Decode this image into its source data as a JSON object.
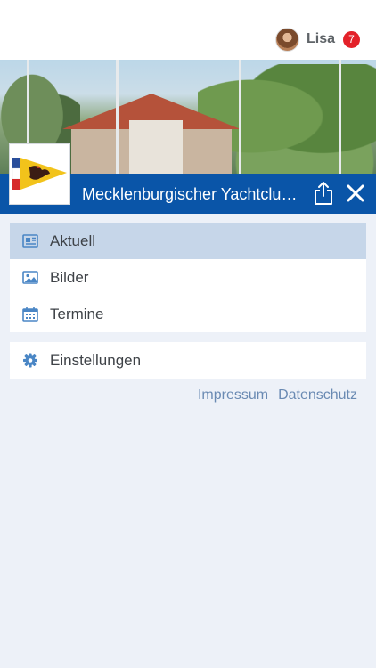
{
  "header": {
    "user_name": "Lisa",
    "notification_count": "7"
  },
  "club": {
    "title": "Mecklenburgischer Yachtclub..."
  },
  "menu": {
    "items": [
      {
        "label": "Aktuell",
        "icon": "newspaper-icon",
        "active": true
      },
      {
        "label": "Bilder",
        "icon": "image-icon",
        "active": false
      },
      {
        "label": "Termine",
        "icon": "calendar-icon",
        "active": false
      }
    ],
    "settings_label": "Einstellungen",
    "settings_icon": "gear-icon"
  },
  "footer_links": {
    "impressum": "Impressum",
    "datenschutz": "Datenschutz"
  },
  "colors": {
    "accent": "#0a55a8",
    "active_item": "#c6d6e9",
    "background": "#edf1f8",
    "badge": "#e32129",
    "icon": "#4a86c5",
    "link": "#6a8ab3"
  }
}
